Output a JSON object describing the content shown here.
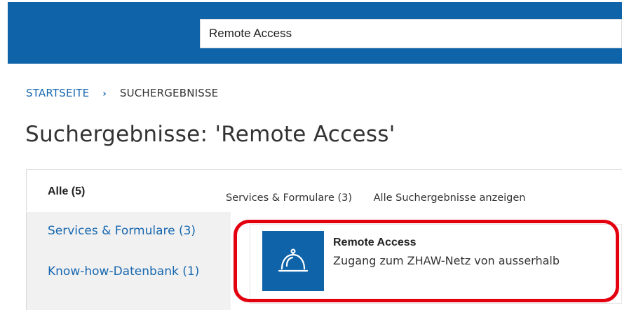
{
  "search": {
    "value": "Remote Access"
  },
  "breadcrumb": {
    "home": "STARTSEITE",
    "separator": "›",
    "current": "SUCHERGEBNISSE"
  },
  "page": {
    "title": "Suchergebnisse: 'Remote Access'"
  },
  "tabs": {
    "all_label": "Alle  (5)"
  },
  "sidebar": {
    "items": [
      {
        "label": "Services & Formulare  (3)"
      },
      {
        "label": "Know-how-Datenbank  (1)"
      }
    ]
  },
  "subtabs": [
    {
      "label": "Services & Formulare (3)"
    },
    {
      "label": "Alle Suchergebnisse anzeigen"
    }
  ],
  "result": {
    "title": "Remote Access",
    "description": "Zugang zum ZHAW-Netz von ausserhalb",
    "icon": "service-bell-icon"
  },
  "colors": {
    "brand_blue": "#0f64a9",
    "link_blue": "#1767b0",
    "highlight_red": "#e3000f",
    "sidebar_bg": "#f1f1f1"
  }
}
